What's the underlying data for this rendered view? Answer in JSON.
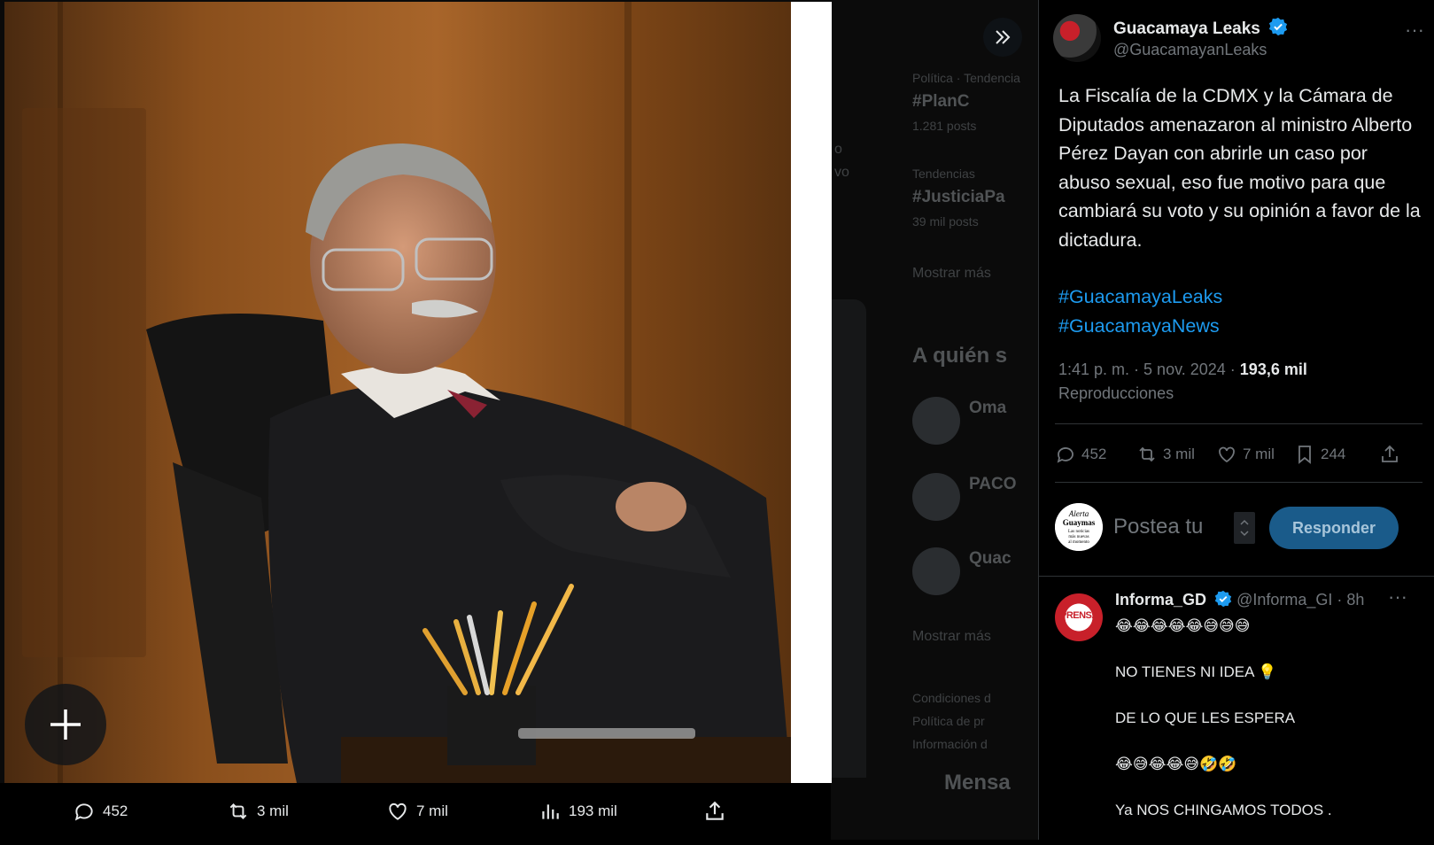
{
  "background_timeline": {
    "trend1_meta": "Política · Tendencia",
    "trend1_tag": "#PlanC",
    "trend1_count": "1.281 posts",
    "trend2_meta": "Tendencias",
    "trend2_tag": "#JusticiaPa",
    "trend2_count": "39 mil posts",
    "show_more_1": "Mostrar más",
    "who_to_follow": "A quién s",
    "user1": "Oma",
    "user2": "PACO",
    "user3": "Quac",
    "show_more_2": "Mostrar más",
    "footer1": "Condiciones d",
    "footer2": "Política de pr",
    "footer3": "Información d",
    "messages": "Mensa",
    "side_text1": "o",
    "side_text2": "vo"
  },
  "viewer": {
    "expand_icon": "chevrons-right-icon",
    "add_icon": "plus-icon",
    "bottom_bar": {
      "replies": "452",
      "reposts": "3 mil",
      "likes": "7 mil",
      "views": "193 mil"
    }
  },
  "tweet": {
    "author_name": "Guacamaya Leaks",
    "author_handle": "@GuacamayanLeaks",
    "text": "La Fiscalía de la CDMX y la Cámara de Diputados amenazaron al ministro Alberto Pérez Dayan con abrirle un caso por abuso sexual, eso fue motivo para que cambiará su voto y su opinión a favor de la dictadura.",
    "hashtags": [
      "#GuacamayaLeaks",
      "#GuacamayaNews"
    ],
    "time": "1:41 p. m.",
    "date": "5 nov. 2024",
    "views_count": "193,6 mil",
    "views_label": "Reproducciones",
    "stats": {
      "replies": "452",
      "reposts": "3 mil",
      "likes": "7 mil",
      "bookmarks": "244"
    }
  },
  "reply_box": {
    "avatar_text": [
      "Alerta",
      "Guaymas",
      "Las noticias",
      "más nuevas",
      "al momento"
    ],
    "placeholder": "Postea tu",
    "button": "Responder"
  },
  "reply": {
    "name": "Informa_GD",
    "handle": "@Informa_GI",
    "time": "8h",
    "avatar_text": "PRENSA",
    "lines": [
      "😂😂😂😂😂😅😅😅",
      "NO TIENES NI IDEA 💡",
      "DE LO QUE LES ESPERA",
      "😂😅😂😂😅🤣🤣",
      "Ya NOS CHINGAMOS TODOS ."
    ]
  },
  "colors": {
    "accent": "#1d9bf0",
    "text_primary": "#e7e9ea",
    "text_secondary": "#71767b",
    "divider": "#2f3336",
    "reply_button": "#1a5b8a"
  }
}
